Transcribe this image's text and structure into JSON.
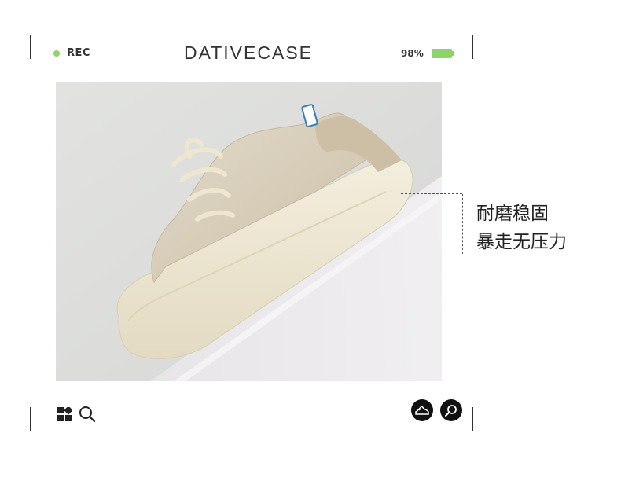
{
  "status_bar": {
    "rec_label": "REC",
    "brand": "DATIVECASE",
    "battery_percent_label": "98%",
    "battery_level": 0.98
  },
  "caption": {
    "line1": "耐磨稳固",
    "line2": "暴走无压力"
  },
  "toolbar": {
    "left_icons": [
      "grid-icon",
      "search-icon"
    ],
    "right_icons": [
      "sneaker-icon",
      "zoom-icon"
    ]
  },
  "colors": {
    "accent_green": "#8fd36a",
    "frame": "#333333",
    "photo_background": "#dfe0de",
    "sole": "#efe9d6",
    "upper": "#d9d0bf"
  }
}
